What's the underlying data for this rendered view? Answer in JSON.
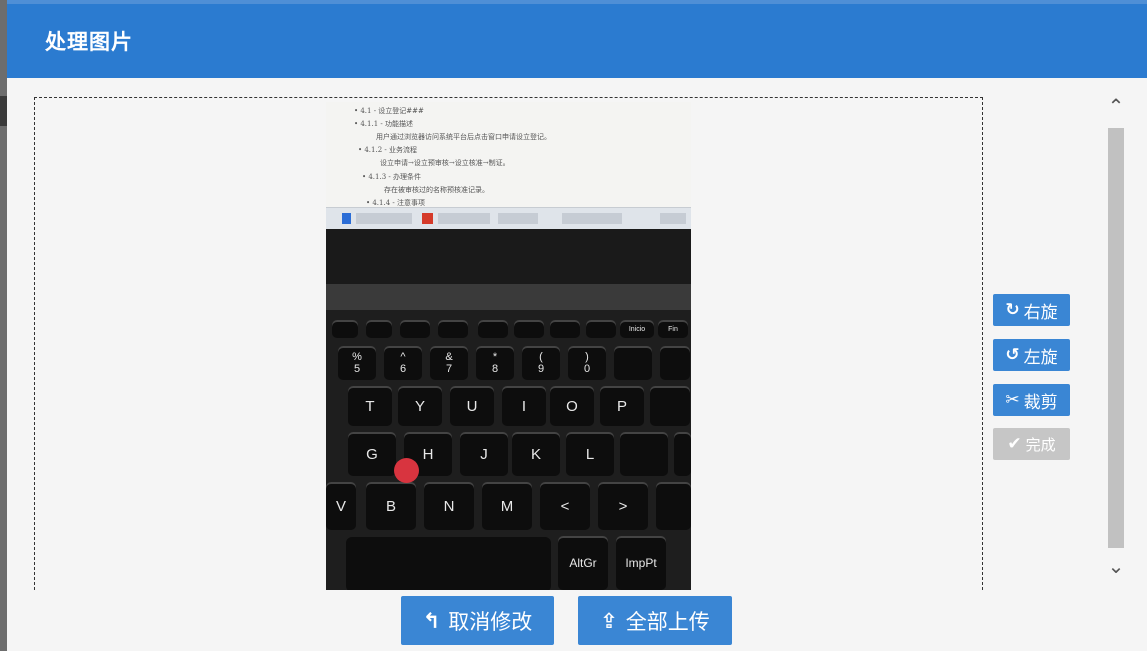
{
  "dialog": {
    "title": "处理图片"
  },
  "photo_content": {
    "doc_lines": [
      "• 4.1 - 设立登记###",
      "• 4.1.1 - 功能描述",
      "用户通过浏览器访问系统平台后点击窗口申请设立登记。",
      "• 4.1.2 - 业务流程",
      "设立申请→设立预审核→设立核准→制证。",
      "• 4.1.3 - 办理条件",
      "存在被审核过的名称预核准记录。",
      "• 4.1.4 - 注意事项"
    ],
    "keys": {
      "row1": [
        "%\n5",
        "^\n6",
        "&\n7",
        "*\n8",
        "(\n9",
        ")\n0"
      ],
      "row2": [
        "T",
        "Y",
        "U",
        "I",
        "O",
        "P"
      ],
      "row3": [
        "G",
        "H",
        "J",
        "K",
        "L"
      ],
      "row4": [
        "V",
        "B",
        "N",
        "M",
        "<",
        ">"
      ],
      "special": [
        "AltGr",
        "ImpPt",
        "Inicio",
        "Fin"
      ]
    }
  },
  "toolbar": {
    "rotate_right": {
      "icon": "rotate-cw-icon",
      "glyph": "↻",
      "label": "右旋"
    },
    "rotate_left": {
      "icon": "rotate-ccw-icon",
      "glyph": "↺",
      "label": "左旋"
    },
    "crop": {
      "icon": "scissors-icon",
      "glyph": "✂",
      "label": "裁剪"
    },
    "done": {
      "icon": "check-icon",
      "glyph": "✔",
      "label": "完成"
    }
  },
  "scrollbar": {
    "up_glyph": "⌃",
    "down_glyph": "⌄"
  },
  "actions": {
    "cancel": {
      "icon": "undo-arrow-icon",
      "glyph": "↰",
      "label": "取消修改"
    },
    "upload": {
      "icon": "upload-icon",
      "glyph": "⇪",
      "label": "全部上传"
    }
  },
  "colors": {
    "titlebar": "#2b7bd0",
    "button": "#3a86d4",
    "button_disabled": "#c6c6c6"
  }
}
